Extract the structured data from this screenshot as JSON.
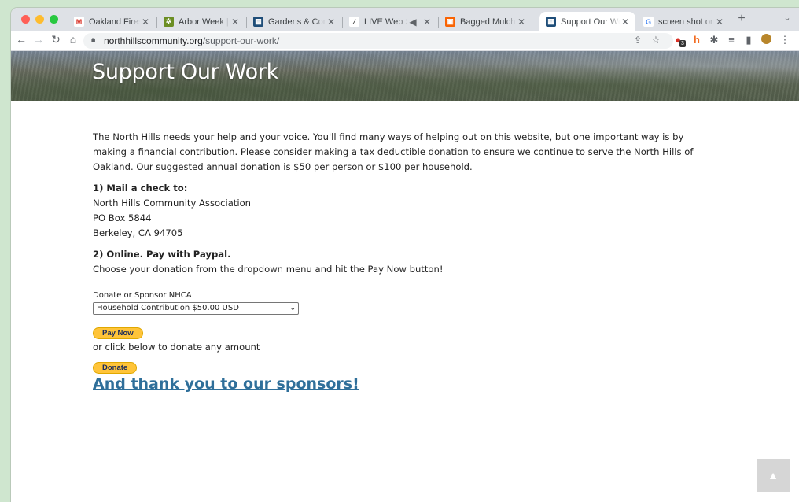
{
  "browser": {
    "tabs": [
      {
        "title": "Oakland Firesafe",
        "favicon": "gmail-icon",
        "color": "#d93025",
        "glyph": "M"
      },
      {
        "title": "Arbor Week | City",
        "favicon": "city-oakland-icon",
        "color": "#6b8e23",
        "glyph": "✲"
      },
      {
        "title": "Gardens & Comm",
        "favicon": "nhca-icon",
        "color": "#1f4e79",
        "glyph": "▦"
      },
      {
        "title": "LIVE Web Str",
        "favicon": "live-icon",
        "color": "#333333",
        "glyph": "∕"
      },
      {
        "title": "Bagged Mulch -",
        "favicon": "homedepot-icon",
        "color": "#f96302",
        "glyph": "▣"
      },
      {
        "title": "Support Our Wor",
        "favicon": "nhca-icon",
        "color": "#1f4e79",
        "glyph": "▦"
      },
      {
        "title": "screen shot on m",
        "favicon": "google-icon",
        "color": "#4285f4",
        "glyph": "G"
      }
    ],
    "url_host": "northhillscommunity.org",
    "url_path": "/support-our-work/",
    "extension_badge": "3"
  },
  "page": {
    "title": "Support Our Work",
    "intro": "The North Hills needs your help and your voice. You'll find many ways of helping out on this website, but one important way is by making a financial contribution. Please consider making a tax deductible donation to ensure we continue to serve the North Hills of Oakland. Our suggested annual donation is $50 per person or $100 per household.",
    "mail_heading": "1) Mail a check to:",
    "address": [
      "North Hills Community Association",
      "PO Box 5844",
      "Berkeley, CA 94705"
    ],
    "online_heading": "2) Online. Pay with Paypal.",
    "online_text": "Choose your donation from the dropdown menu and hit the Pay Now button!",
    "form_label": "Donate or Sponsor NHCA",
    "select_value": "Household Contribution $50.00 USD",
    "pay_now_label": "Pay Now",
    "or_text": "or click below to donate any amount",
    "donate_label": "Donate",
    "sponsors_link": "And thank you to our sponsors!"
  },
  "colors": {
    "accent_link": "#2f6f9a",
    "paypal_yellow": "#ffc439"
  }
}
